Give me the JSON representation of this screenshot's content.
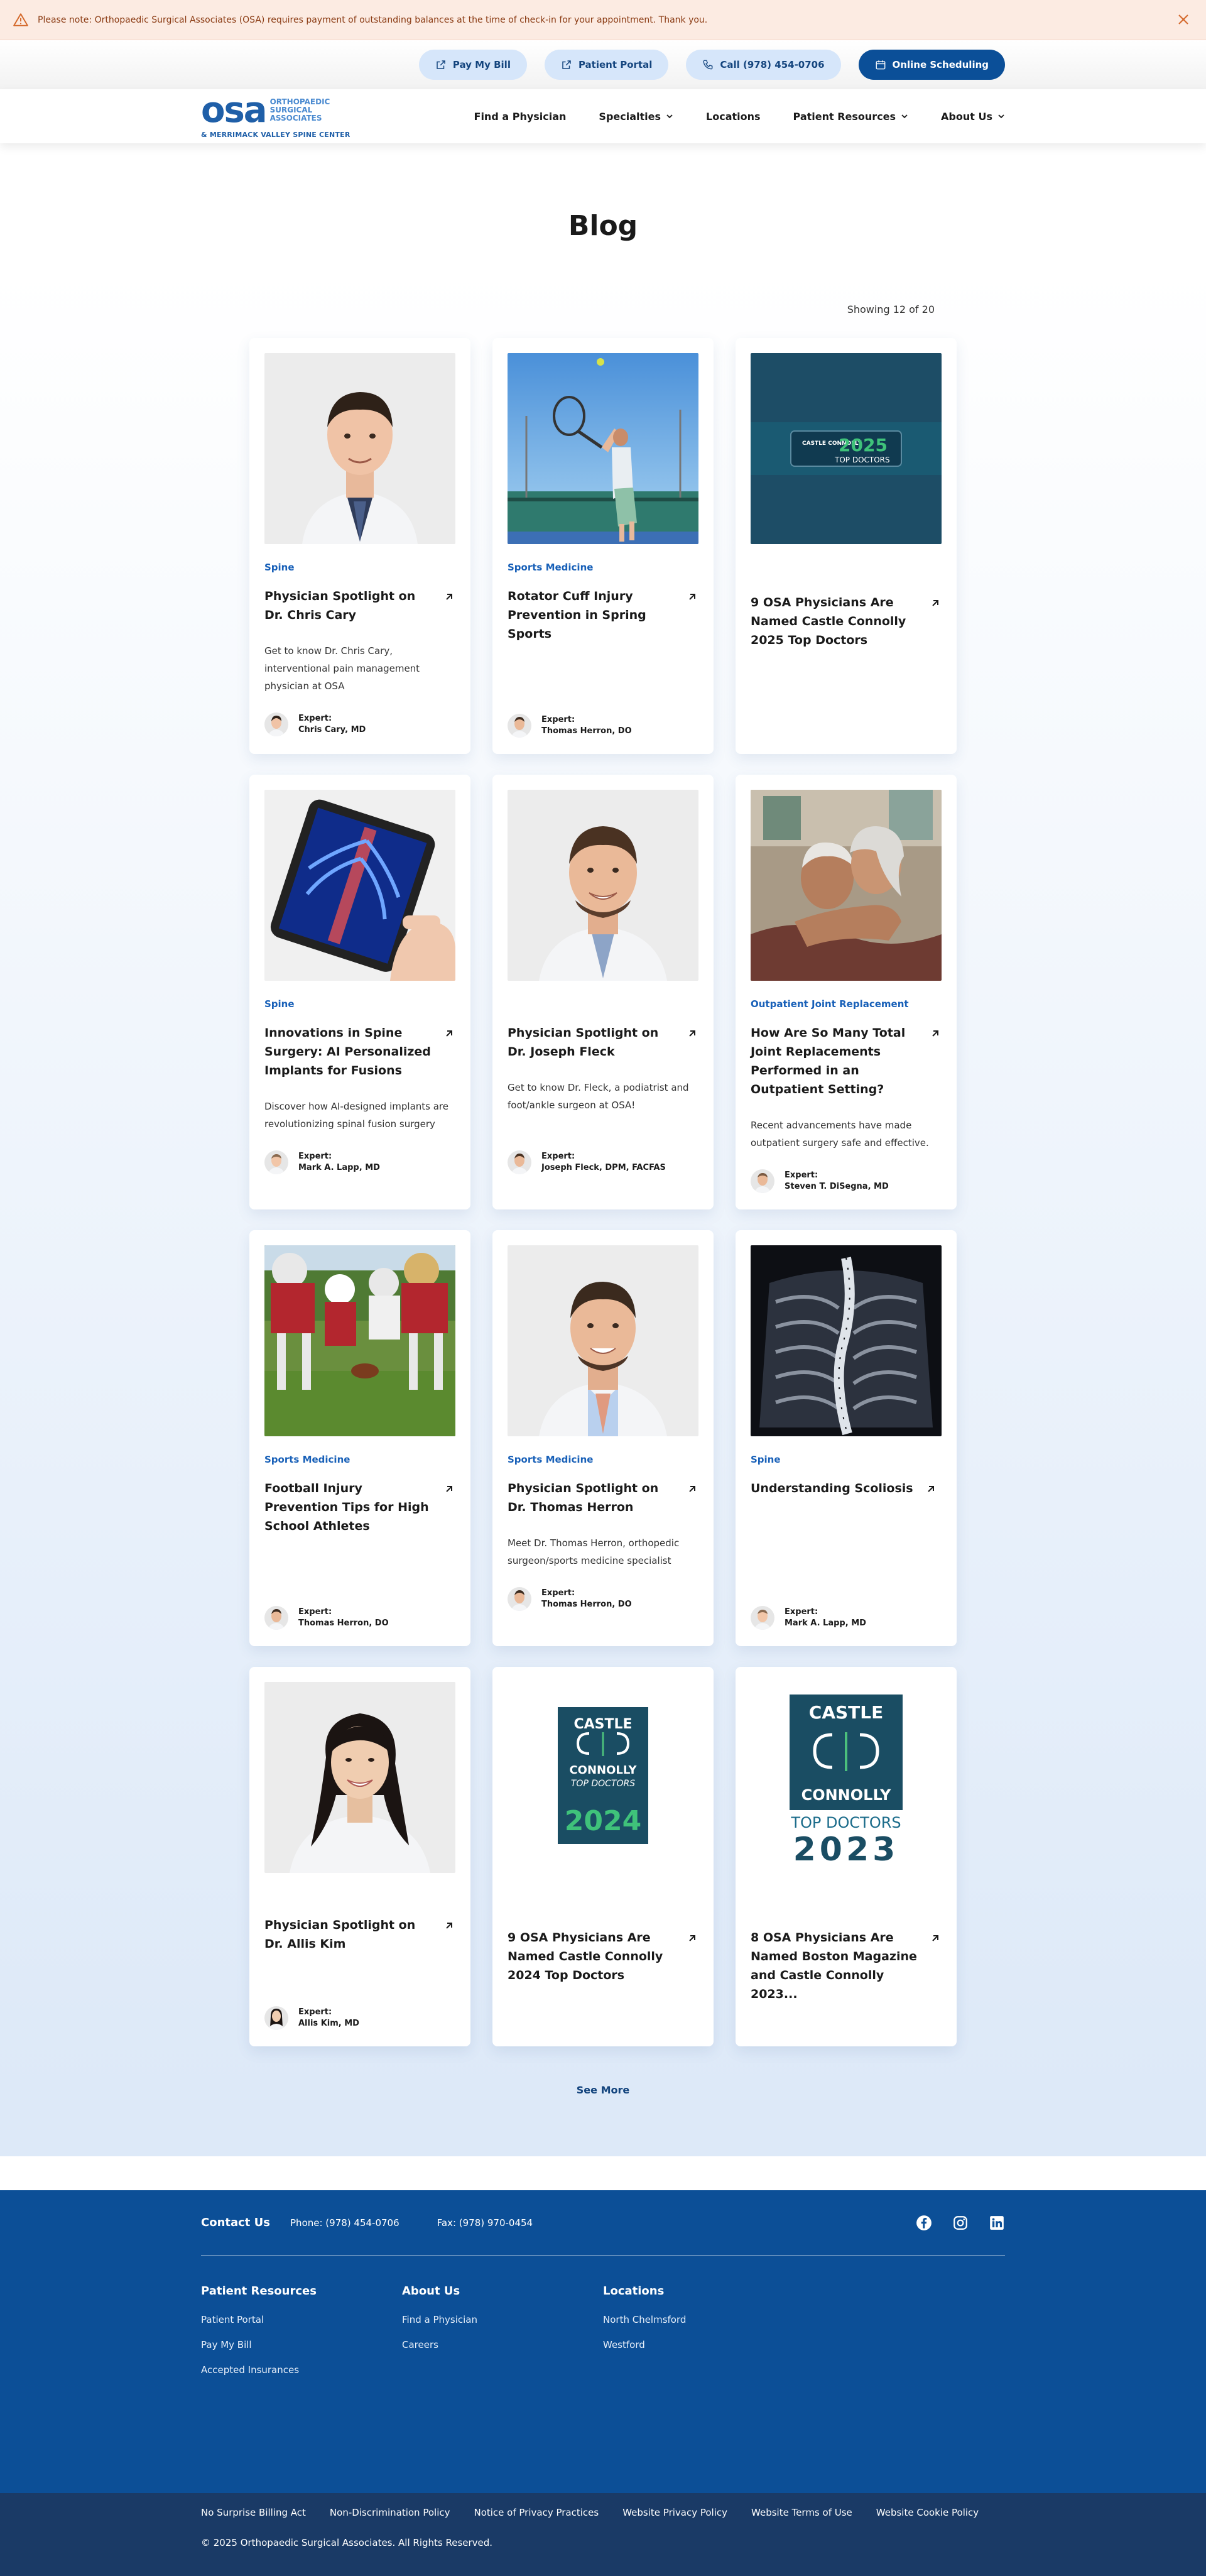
{
  "notice": {
    "text": "Please note: Orthopaedic Surgical Associates (OSA) requires payment of outstanding balances at the time of check-in for your appointment. Thank you."
  },
  "utility": {
    "pay_bill": "Pay My Bill",
    "portal": "Patient Portal",
    "call": "Call (978) 454-0706",
    "scheduling": "Online Scheduling"
  },
  "logo": {
    "mark": "osa",
    "line1": "ORTHOPAEDIC",
    "line2": "SURGICAL",
    "line3": "ASSOCIATES",
    "subtitle": "& MERRIMACK VALLEY SPINE CENTER"
  },
  "nav": {
    "find_physician": "Find a Physician",
    "specialties": "Specialties",
    "locations": "Locations",
    "patient_resources": "Patient Resources",
    "about_us": "About Us"
  },
  "blog": {
    "title": "Blog",
    "showing": "Showing 12 of 20",
    "expert_label": "Expert:",
    "see_more": "See More",
    "cards": [
      {
        "category": "Spine",
        "title": "Physician Spotlight on Dr. Chris Cary",
        "excerpt": "Get to know Dr. Chris Cary, interventional pain management physician at OSA",
        "expert": "Chris Cary, MD"
      },
      {
        "category": "Sports Medicine",
        "title": "Rotator Cuff Injury Prevention in Spring Sports",
        "excerpt": "",
        "expert": "Thomas Herron, DO"
      },
      {
        "category": "",
        "title": "9 OSA Physicians Are Named Castle Connolly 2025 Top Doctors",
        "excerpt": "",
        "expert": "",
        "badge_year": "2025",
        "badge_text": "TOP DOCTORS",
        "badge_brand": "CASTLE CONNOLLY"
      },
      {
        "category": "Spine",
        "title": "Innovations in Spine Surgery: AI Personalized Implants for Fusions",
        "excerpt": "Discover how AI-designed implants are revolutionizing spinal fusion surgery",
        "expert": "Mark A. Lapp, MD"
      },
      {
        "category": "",
        "title": "Physician Spotlight on Dr. Joseph Fleck",
        "excerpt": "Get to know Dr. Fleck, a podiatrist and foot/ankle surgeon at OSA!",
        "expert": "Joseph Fleck, DPM, FACFAS"
      },
      {
        "category": "Outpatient Joint Replacement",
        "title": "How Are So Many Total Joint Replacements Performed in an Outpatient Setting?",
        "excerpt": "Recent advancements have made outpatient surgery safe and effective.",
        "expert": "Steven T. DiSegna, MD"
      },
      {
        "category": "Sports Medicine",
        "title": "Football Injury Prevention Tips for High School Athletes",
        "excerpt": "",
        "expert": "Thomas Herron, DO"
      },
      {
        "category": "Sports Medicine",
        "title": "Physician Spotlight on Dr. Thomas Herron",
        "excerpt": "Meet Dr. Thomas Herron, orthopedic surgeon/sports medicine specialist",
        "expert": "Thomas Herron, DO"
      },
      {
        "category": "Spine",
        "title": "Understanding Scoliosis",
        "excerpt": "",
        "expert": "Mark A. Lapp, MD"
      },
      {
        "category": "",
        "title": "Physician Spotlight on Dr. Allis Kim",
        "excerpt": "",
        "expert": "Allis Kim, MD"
      },
      {
        "category": "",
        "title": "9 OSA Physicians Are Named Castle Connolly 2024 Top Doctors",
        "excerpt": "",
        "expert": "",
        "badge_line1": "CASTLE",
        "badge_line2": "CONNOLLY",
        "badge_line3": "TOP DOCTORS",
        "badge_year": "2024"
      },
      {
        "category": "",
        "title": "8 OSA Physicians Are Named Boston Magazine and Castle Connolly 2023...",
        "excerpt": "",
        "expert": "",
        "badge_line1": "CASTLE",
        "badge_line2": "CONNOLLY",
        "badge_line3": "TOP DOCTORS",
        "badge_year": "2023"
      }
    ]
  },
  "footer": {
    "contact_title": "Contact Us",
    "phone": "Phone: (978) 454-0706",
    "fax": "Fax: (978) 970-0454",
    "col1_title": "Patient Resources",
    "col1_links": [
      "Patient Portal",
      "Pay My Bill",
      "Accepted Insurances"
    ],
    "col2_title": "About Us",
    "col2_links": [
      "Find a Physician",
      "Careers"
    ],
    "col3_title": "Locations",
    "col3_links": [
      "North Chelmsford",
      "Westford"
    ],
    "legal_links": [
      "No Surprise Billing Act",
      "Non-Discrimination Policy",
      "Notice of Privacy Practices",
      "Website Privacy Policy",
      "Website Terms of Use",
      "Website Cookie Policy"
    ],
    "copyright": "© 2025 Orthopaedic Surgical Associates. All Rights Reserved."
  },
  "colors": {
    "brand_blue": "#0b4f98",
    "category_blue": "#1860b8",
    "notice_bg": "#fcebe2",
    "footer_bg": "#0c4f97",
    "legal_bg": "#1a3a66"
  },
  "icons": [
    "warning-icon",
    "close-icon",
    "external-link-icon",
    "phone-icon",
    "calendar-icon",
    "chevron-down-icon",
    "arrow-up-right-icon",
    "facebook-icon",
    "instagram-icon",
    "linkedin-icon"
  ]
}
